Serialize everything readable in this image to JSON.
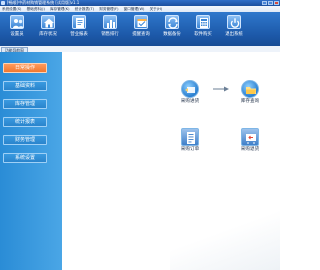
{
  "window": {
    "title": "[畅顺]中药材购销管理系统 [试用版]v1.1"
  },
  "menu": [
    "系统设置(S)",
    "基础资料(J)",
    "库存管理(K)",
    "统计报表(T)",
    "财务管理(F)",
    "窗口管理(W)",
    "关于(H)"
  ],
  "toolbar": [
    {
      "label": "设置员",
      "icon": "users-icon"
    },
    {
      "label": "库存状况",
      "icon": "home-icon"
    },
    {
      "label": "营业报表",
      "icon": "report-icon"
    },
    {
      "label": "销售排行",
      "icon": "rank-chart-icon"
    },
    {
      "label": "提醒查询",
      "icon": "reminder-icon"
    },
    {
      "label": "数据备份",
      "icon": "backup-icon"
    },
    {
      "label": "软件购买",
      "icon": "calculator-icon"
    },
    {
      "label": "退出系统",
      "icon": "power-icon"
    }
  ],
  "tab": {
    "label": "功能导航窗"
  },
  "sidebar": [
    {
      "label": "日常操作",
      "active": true
    },
    {
      "label": "基础资料",
      "active": false
    },
    {
      "label": "库存管理",
      "active": false
    },
    {
      "label": "统计报表",
      "active": false
    },
    {
      "label": "财务管理",
      "active": false
    },
    {
      "label": "系统设置",
      "active": false
    }
  ],
  "flow": [
    {
      "label": "采购进货",
      "icon": "purchase-in-icon"
    },
    {
      "label": "库存查询",
      "icon": "inventory-folder-icon"
    },
    {
      "label": "采购订单",
      "icon": "purchase-order-icon"
    },
    {
      "label": "采购退货",
      "icon": "purchase-return-icon"
    }
  ],
  "colors": {
    "toolbar_bg": "#1c58a8",
    "sidebar_bg": "#3a9ae0",
    "sidebar_active": "#f0782f"
  }
}
